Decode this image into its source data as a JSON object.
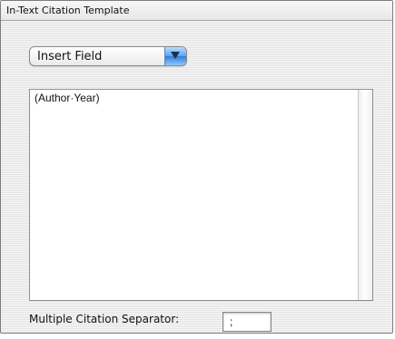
{
  "window": {
    "title": "In-Text Citation Template"
  },
  "insert_field": {
    "label": "Insert Field",
    "arrow_icon": "triangle-down-icon"
  },
  "template_text": "(Author·Year)",
  "separator": {
    "label": "Multiple Citation Separator:",
    "value": ";"
  },
  "colors": {
    "popup_accent": "#5aa3ef",
    "panel_background": "#ececec"
  }
}
